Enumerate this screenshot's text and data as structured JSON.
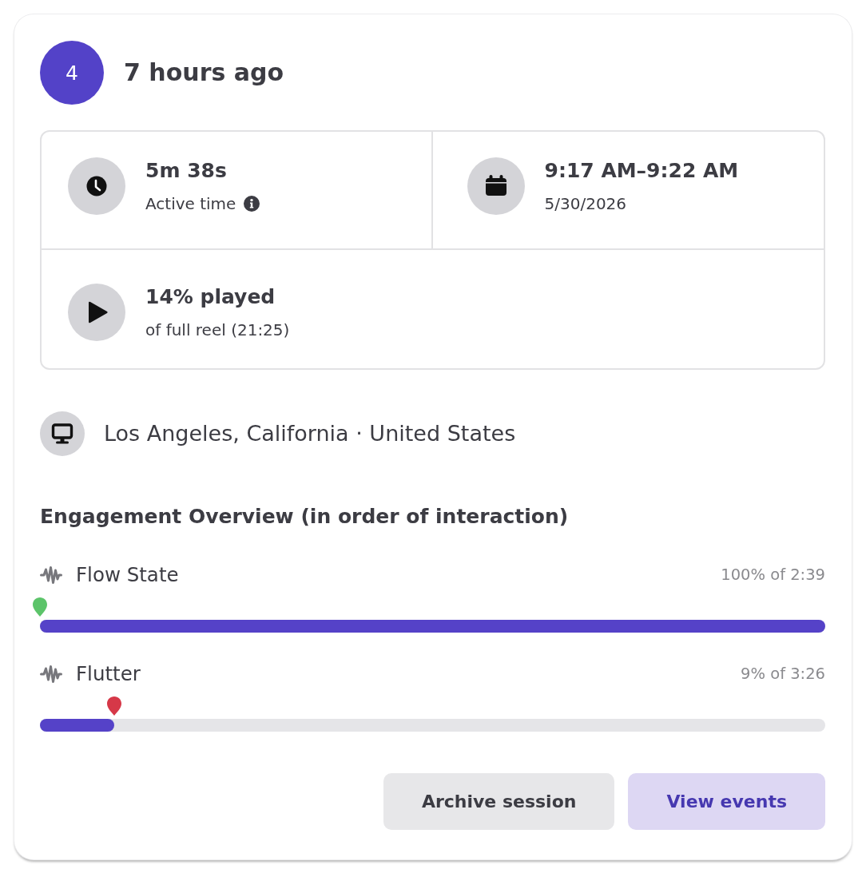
{
  "session": {
    "number": "4",
    "time_ago": "7 hours ago"
  },
  "stats": [
    {
      "kind": "duration",
      "value": "5m 38s",
      "label": "Active time",
      "info": true
    },
    {
      "kind": "date",
      "value": "9:17 AM–9:22 AM",
      "label": "5/30/2026",
      "info": false
    },
    {
      "kind": "playback",
      "value": "14% played",
      "label": "of full reel (21:25)",
      "info": false
    }
  ],
  "location": {
    "kind": "desktop",
    "text": "Los Angeles, California · United States"
  },
  "engagement": {
    "title": "Engagement Overview (in order of interaction)",
    "items": [
      {
        "label": "Flow State",
        "reading": "100% of 2:39",
        "level": 1,
        "marker": {
          "color": "#5cc46a",
          "level": 0
        }
      },
      {
        "label": "Flutter",
        "reading": "9% of 3:26",
        "level": 0.095,
        "marker": {
          "color": "#d63848",
          "level": 0.095
        }
      }
    ]
  },
  "actions": [
    {
      "label": "Archive session",
      "kind": "secondary"
    },
    {
      "label": "View events",
      "kind": "primary"
    }
  ]
}
